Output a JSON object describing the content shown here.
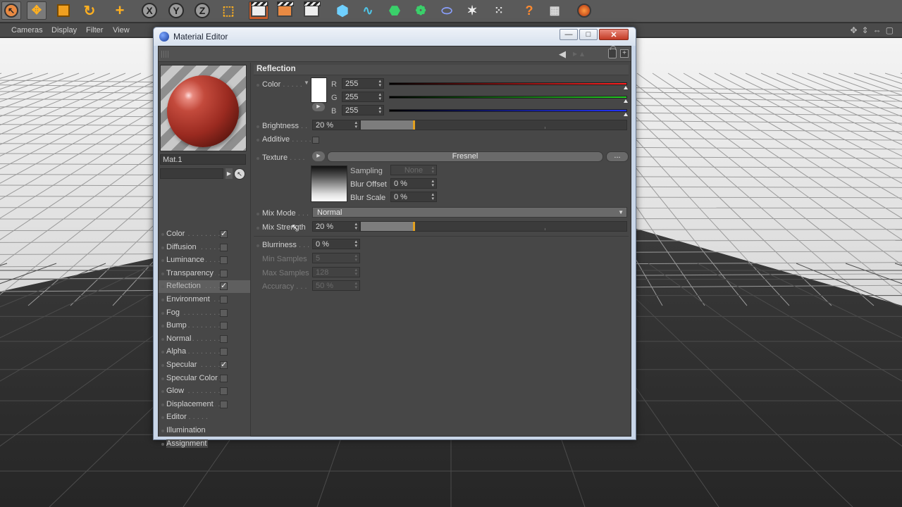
{
  "toolbar": {
    "icons": [
      "selection-tool-icon",
      "move-icon",
      "scale-icon",
      "rotate-icon",
      "add-icon",
      "x-axis-icon",
      "y-axis-icon",
      "z-axis-icon",
      "coordinate-system-icon",
      "render-view-icon",
      "render-region-icon",
      "render-settings-icon",
      "cube-icon",
      "spline-icon",
      "nurbs-icon",
      "array-icon",
      "deformer-icon",
      "scene-icon",
      "hair-icon",
      "light-icon",
      "help-icon",
      "layout-icon"
    ],
    "axis_labels": {
      "x": "X",
      "y": "Y",
      "z": "Z"
    }
  },
  "viewport": {
    "menu": [
      "Cameras",
      "Display",
      "Filter",
      "View"
    ]
  },
  "window": {
    "title": "Material Editor",
    "buttons": {
      "minimize": "—",
      "maximize": "□",
      "close": "✕"
    }
  },
  "material": {
    "name": "Mat.1"
  },
  "channels": [
    {
      "label": "Color",
      "checked": true,
      "selected": false
    },
    {
      "label": "Diffusion",
      "checked": false,
      "selected": false
    },
    {
      "label": "Luminance",
      "checked": false,
      "selected": false
    },
    {
      "label": "Transparency",
      "checked": false,
      "selected": false
    },
    {
      "label": "Reflection",
      "checked": true,
      "selected": true
    },
    {
      "label": "Environment",
      "checked": false,
      "selected": false
    },
    {
      "label": "Fog",
      "checked": false,
      "selected": false
    },
    {
      "label": "Bump",
      "checked": false,
      "selected": false
    },
    {
      "label": "Normal",
      "checked": false,
      "selected": false
    },
    {
      "label": "Alpha",
      "checked": false,
      "selected": false
    },
    {
      "label": "Specular",
      "checked": true,
      "selected": false
    },
    {
      "label": "Specular Color",
      "checked": false,
      "selected": false
    },
    {
      "label": "Glow",
      "checked": false,
      "selected": false
    },
    {
      "label": "Displacement",
      "checked": false,
      "selected": false
    },
    {
      "label": "Editor",
      "checked": null,
      "selected": false
    },
    {
      "label": "Illumination",
      "checked": null,
      "selected": false
    },
    {
      "label": "Assignment",
      "checked": null,
      "selected": false
    }
  ],
  "reflection": {
    "title": "Reflection",
    "color": {
      "label": "Color",
      "swatch": "#ffffff",
      "r": {
        "label": "R",
        "value": "255",
        "color": "#ff2020"
      },
      "g": {
        "label": "G",
        "value": "255",
        "color": "#22cc22"
      },
      "b": {
        "label": "B",
        "value": "255",
        "color": "#2233ff"
      }
    },
    "brightness": {
      "label": "Brightness",
      "value": "20 %",
      "level": 0.2
    },
    "additive": {
      "label": "Additive",
      "checked": false
    },
    "texture": {
      "label": "Texture",
      "shader": "Fresnel",
      "more": "...",
      "sampling": {
        "label": "Sampling",
        "value": "None"
      },
      "blur_offset": {
        "label": "Blur Offset",
        "value": "0 %"
      },
      "blur_scale": {
        "label": "Blur Scale",
        "value": "0 %"
      }
    },
    "mix_mode": {
      "label": "Mix Mode",
      "value": "Normal"
    },
    "mix_strength": {
      "label": "Mix Strength",
      "value": "20 %",
      "level": 0.2
    },
    "blurriness": {
      "label": "Blurriness",
      "value": "0 %"
    },
    "min_samples": {
      "label": "Min Samples",
      "value": "5"
    },
    "max_samples": {
      "label": "Max Samples",
      "value": "128"
    },
    "accuracy": {
      "label": "Accuracy",
      "value": "50 %"
    }
  }
}
